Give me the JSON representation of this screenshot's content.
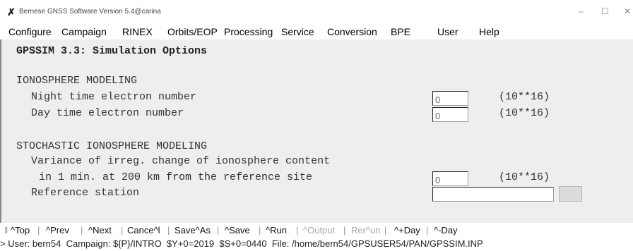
{
  "window": {
    "title": "Bernese GNSS Software Version 5.4@carina",
    "icon": "x-logo-icon",
    "controls": {
      "minimize": "–",
      "maximize": "☐",
      "close": "✕"
    }
  },
  "menu": {
    "items": [
      "Configure",
      "Campaign",
      "RINEX",
      "Orbits/EOP",
      "Processing",
      "Service",
      "Conversion",
      "BPE",
      "User",
      "Help"
    ]
  },
  "panel": {
    "title": "GPSSIM 3.3: Simulation Options",
    "sections": {
      "ionosphere": {
        "heading": "IONOSPHERE MODELING",
        "night_label": "Night time electron number",
        "night_value": "0",
        "night_unit": "(10**16)",
        "day_label": "Day time electron number",
        "day_value": "0",
        "day_unit": "(10**16)"
      },
      "stochastic": {
        "heading": "STOCHASTIC IONOSPHERE MODELING",
        "variance_label_1": "Variance of irreg. change of ionosphere content",
        "variance_label_2": "in 1 min. at 200 km from the reference site",
        "variance_value": "0",
        "variance_unit": "(10**16)",
        "refstation_label": "Reference station",
        "refstation_value": ""
      }
    }
  },
  "toolbar": {
    "buttons": [
      "^Top",
      "^Prev",
      "^Next",
      "Cance^l",
      "Save^As",
      "^Save",
      "^Run",
      "^Output",
      "Rer^un",
      "^+Day",
      "^-Day"
    ],
    "disabled": [
      "^Output",
      "Rer^un"
    ]
  },
  "status": {
    "text": "> User: bern54  Campaign: ${P}/INTRO  $Y+0=2019  $S+0=0440  File: /home/bern54/GPSUSER54/PAN/GPSSIM.INP"
  },
  "colors": {
    "panel_bg": "#eeeeee",
    "window_bg": "#ffffff",
    "disabled_text": "#a8a8a8"
  }
}
